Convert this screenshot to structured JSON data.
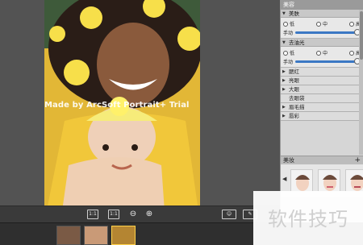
{
  "photo": {
    "watermark": "Made by ArcSoft Portrait+ Trial"
  },
  "toolbar": {
    "fit_label": "1:1",
    "actual_label": "1:1",
    "zoom_out_icon": "zoom-out-icon",
    "zoom_in_icon": "zoom-in-icon",
    "face_icon": "face-icon",
    "eraser_icon": "eraser-icon"
  },
  "panel": {
    "title": "美容",
    "smooth": {
      "label": "美肤",
      "options": [
        "低",
        "中",
        "高"
      ],
      "manual_label": "手动",
      "manual_level": 0.95
    },
    "blemish": {
      "label": "去油光",
      "options": [
        "低",
        "中",
        "高"
      ],
      "manual_label": "手动",
      "manual_level": 0.95
    },
    "items": [
      "腮红",
      "亮眼",
      "大眼",
      "去眼袋",
      "眉毛描",
      "唇彩"
    ]
  },
  "beauty_presets": {
    "label": "美妆",
    "add": "+"
  },
  "brand_overlay": {
    "text": "软件技巧"
  },
  "colors": {
    "photo_bg": "#e7c23a",
    "slider": "#3b78c4"
  }
}
